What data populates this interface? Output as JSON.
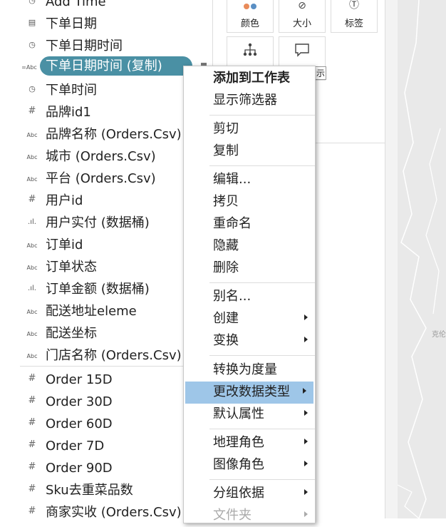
{
  "fields": [
    {
      "icon": "Aa",
      "label": "Add Time"
    },
    {
      "icon": "cal",
      "label": "下单日期"
    },
    {
      "icon": "cal",
      "label": "下单日期时间"
    },
    {
      "icon": "=Abc",
      "label": "下单日期时间 (复制)",
      "selected": true
    },
    {
      "icon": "cal",
      "label": "下单时间"
    },
    {
      "icon": "#",
      "label": "品牌id1"
    },
    {
      "icon": "Abc",
      "label": "品牌名称 (Orders.Csv)"
    },
    {
      "icon": "Abc",
      "label": "城市 (Orders.Csv)"
    },
    {
      "icon": "Abc",
      "label": "平台 (Orders.Csv)"
    },
    {
      "icon": "#",
      "label": "用户id"
    },
    {
      "icon": "bin",
      "label": "用户实付 (数据桶)"
    },
    {
      "icon": "Abc",
      "label": "订单id"
    },
    {
      "icon": "Abc",
      "label": "订单状态"
    },
    {
      "icon": "bin",
      "label": "订单金额 (数据桶)"
    },
    {
      "icon": "Abc",
      "label": "配送地址eleme"
    },
    {
      "icon": "Abc",
      "label": "配送坐标"
    },
    {
      "icon": "Abc",
      "label": "门店名称 (Orders.Csv)"
    },
    {
      "icon": "#",
      "label": "Order 15D"
    },
    {
      "icon": "#",
      "label": "Order 30D"
    },
    {
      "icon": "#",
      "label": "Order 60D"
    },
    {
      "icon": "#",
      "label": "Order 7D"
    },
    {
      "icon": "#",
      "label": "Order 90D"
    },
    {
      "icon": "#",
      "label": "Sku去重菜品数"
    },
    {
      "icon": "#",
      "label": "商家实收 (Orders.Csv)"
    }
  ],
  "marks": {
    "color_label": "颜色",
    "size_label": "大小",
    "label_label": "标签",
    "detail_label": "",
    "tooltip_label": "示"
  },
  "menu": [
    {
      "label": "添加到工作表",
      "bold": true
    },
    {
      "label": "显示筛选器"
    },
    {
      "sep": true
    },
    {
      "label": "剪切"
    },
    {
      "label": "复制"
    },
    {
      "sep": true
    },
    {
      "label": "编辑..."
    },
    {
      "label": "拷贝"
    },
    {
      "label": "重命名"
    },
    {
      "label": "隐藏"
    },
    {
      "label": "删除"
    },
    {
      "sep": true
    },
    {
      "label": "别名..."
    },
    {
      "label": "创建",
      "submenu": true
    },
    {
      "label": "变换",
      "submenu": true
    },
    {
      "sep": true
    },
    {
      "label": "转换为度量"
    },
    {
      "label": "更改数据类型",
      "submenu": true,
      "highlighted": true
    },
    {
      "label": "默认属性",
      "submenu": true
    },
    {
      "sep": true
    },
    {
      "label": "地理角色",
      "submenu": true
    },
    {
      "label": "图像角色",
      "submenu": true
    },
    {
      "sep": true
    },
    {
      "label": "分组依据",
      "submenu": true
    },
    {
      "label": "文件夹",
      "submenu": true,
      "disabled": true
    }
  ],
  "map": {
    "label": "克伦"
  }
}
